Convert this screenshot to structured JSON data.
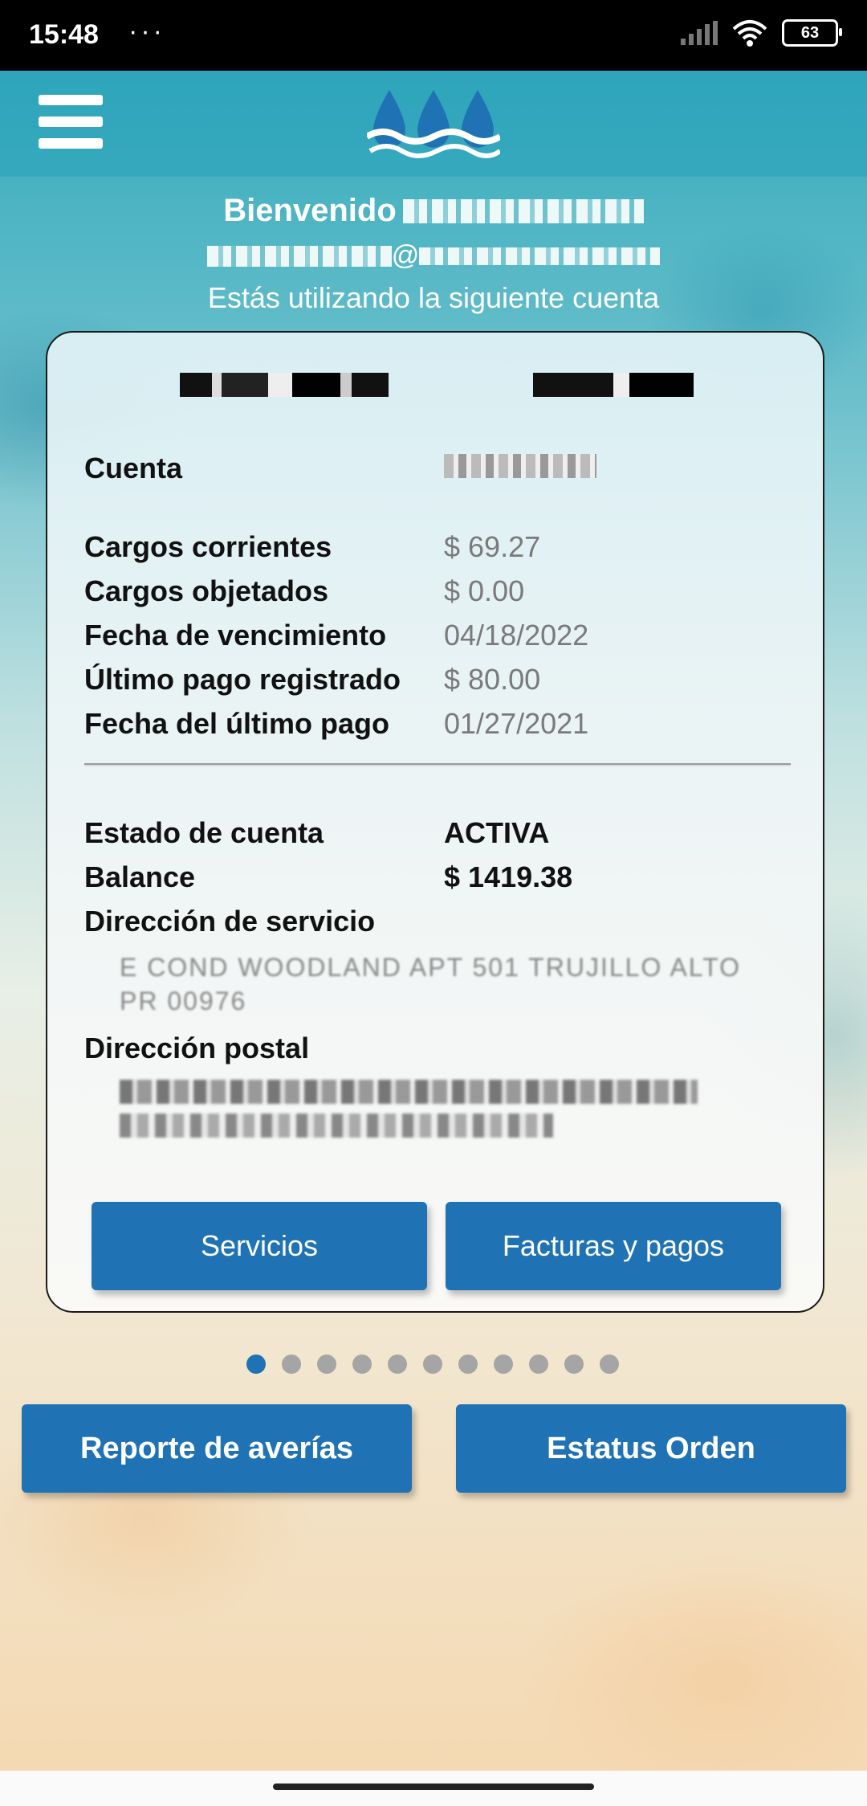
{
  "status_bar": {
    "time": "15:48",
    "dots": "···",
    "battery": "63"
  },
  "welcome": {
    "greeting": "Bienvenido",
    "email_at": "@",
    "subtitle": "Estás utilizando la siguiente cuenta"
  },
  "account": {
    "rows": [
      {
        "label": "Cuenta",
        "value": ""
      },
      {
        "label": "Cargos corrientes",
        "value": "$ 69.27"
      },
      {
        "label": "Cargos objetados",
        "value": "$ 0.00"
      },
      {
        "label": "Fecha de vencimiento",
        "value": "04/18/2022"
      },
      {
        "label": "Último pago registrado",
        "value": "$ 80.00"
      },
      {
        "label": "Fecha del último pago",
        "value": "01/27/2021"
      },
      {
        "label": "Estado de cuenta",
        "value": "ACTIVA"
      },
      {
        "label": "Balance",
        "value": "$ 1419.38"
      },
      {
        "label": "Dirección de servicio",
        "value": ""
      },
      {
        "label": "Dirección postal",
        "value": ""
      }
    ],
    "service_address_line1": "E COND WOODLAND APT 501 TRUJILLO ALTO",
    "service_address_line2": "PR 00976",
    "buttons": {
      "services": "Servicios",
      "bills": "Facturas y pagos"
    }
  },
  "pager": {
    "count": 11,
    "active": 0
  },
  "actions": {
    "report": "Reporte de averías",
    "order_status": "Estatus Orden"
  },
  "colors": {
    "primary": "#1f73b5",
    "accent_teal": "#2aa7b8"
  },
  "icons": {
    "menu": "menu-icon",
    "logo": "water-drops-logo"
  }
}
